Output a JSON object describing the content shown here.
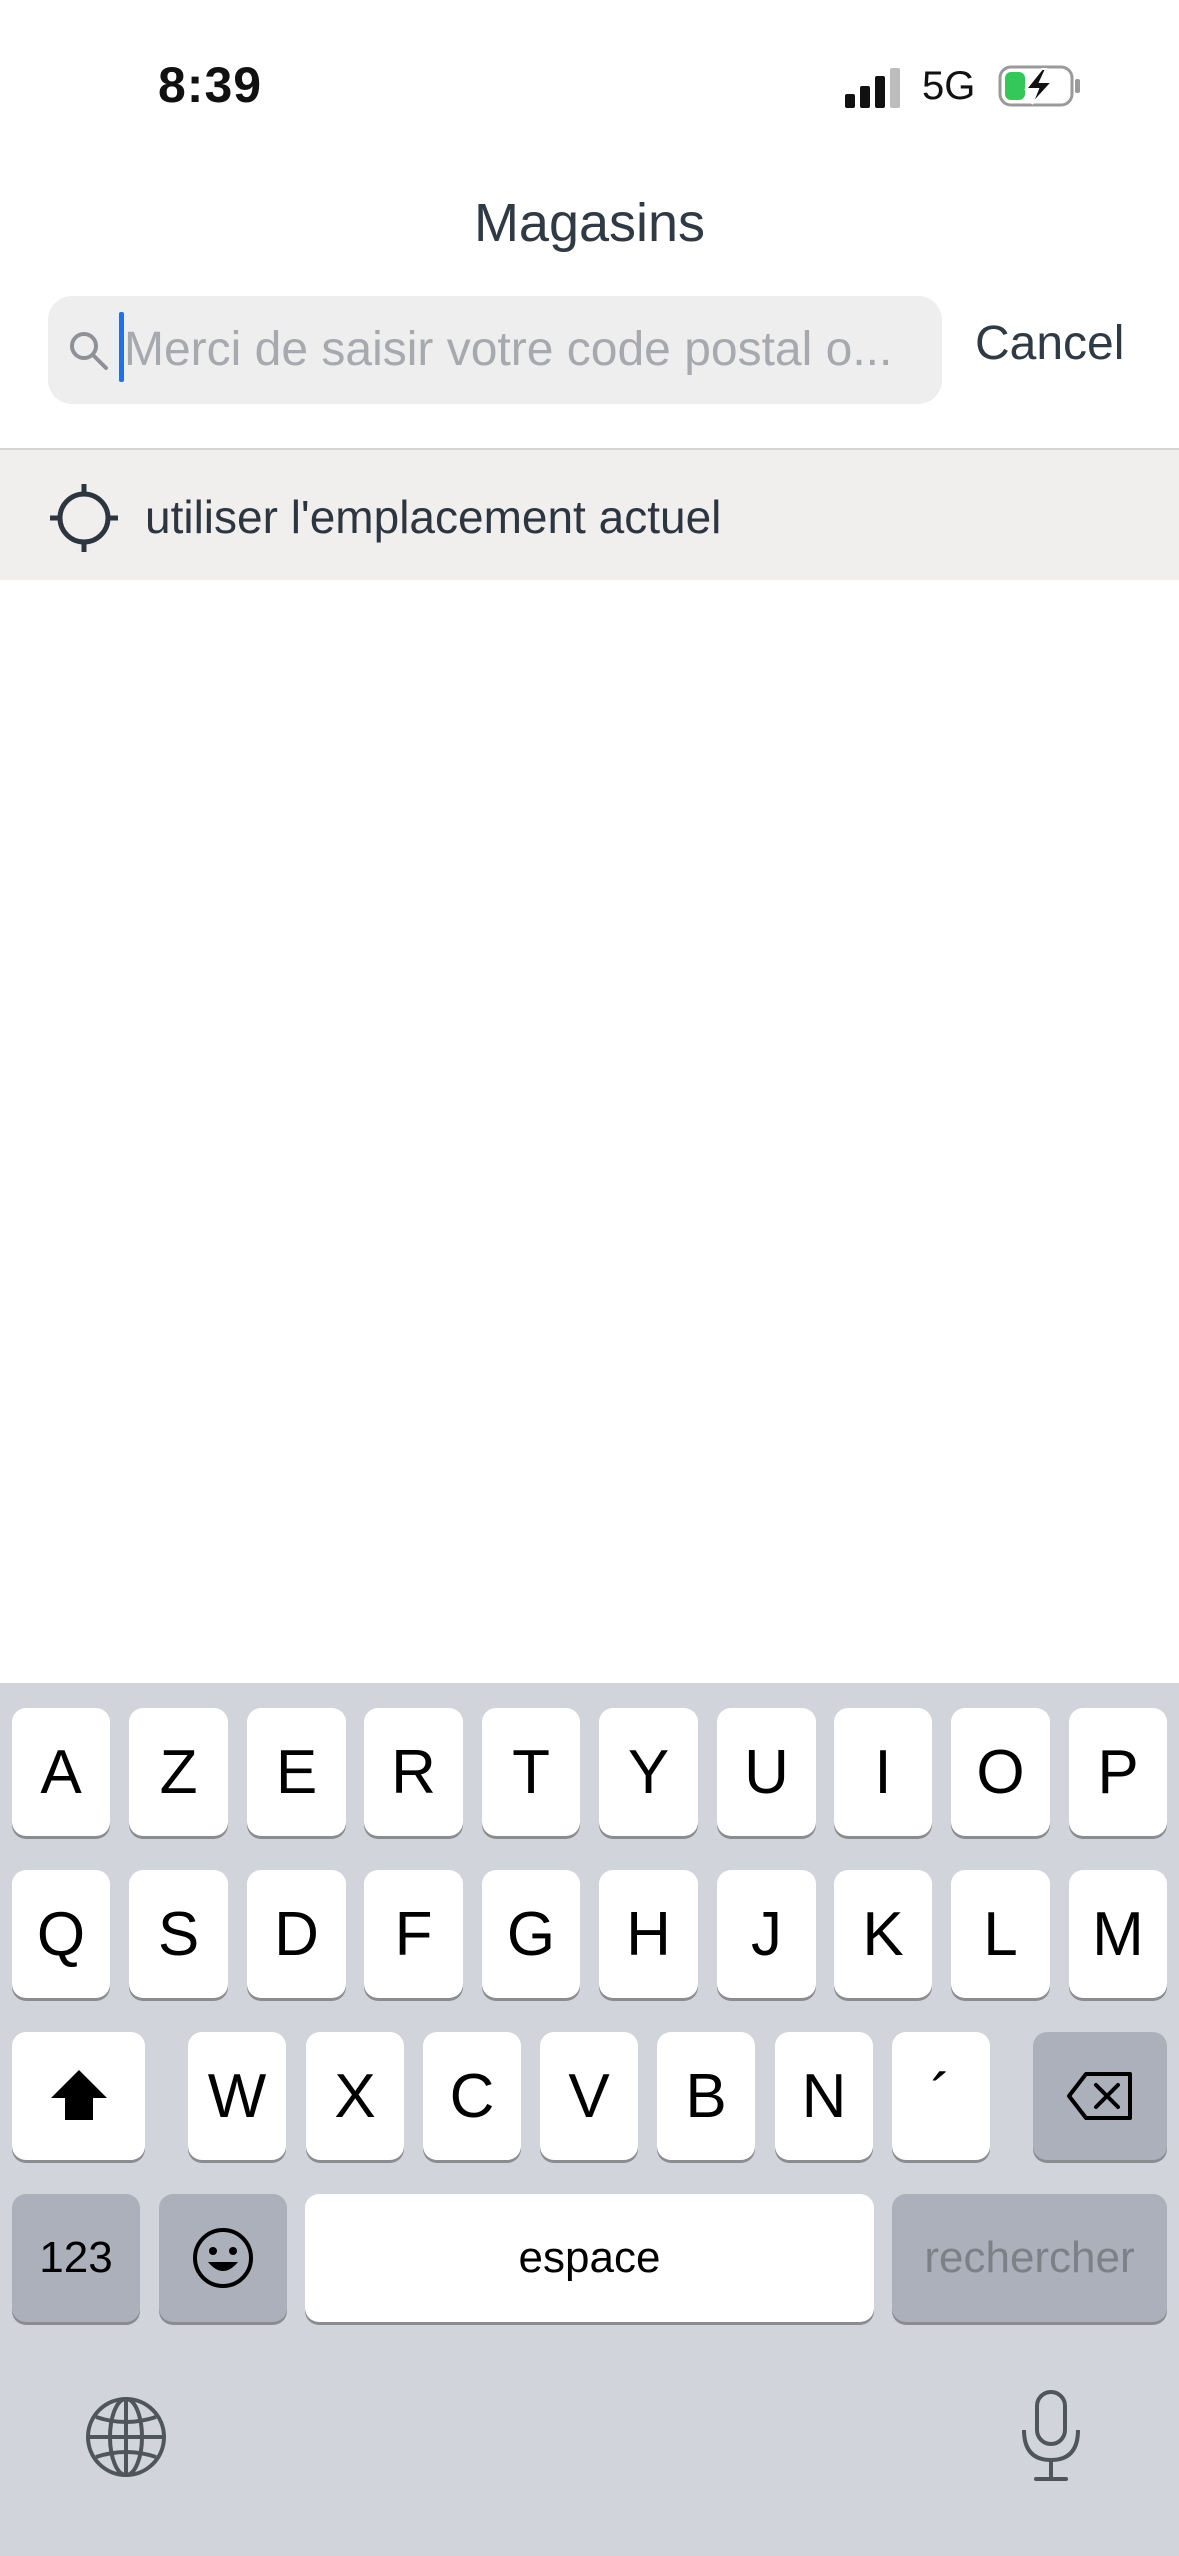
{
  "status_bar": {
    "time": "8:39",
    "network": "5G"
  },
  "header": {
    "title": "Magasins"
  },
  "search": {
    "placeholder": "Merci de saisir votre code postal o...",
    "value": "",
    "cancel_label": "Cancel"
  },
  "location_option": {
    "label": "utiliser l'emplacement actuel"
  },
  "keyboard": {
    "row1": [
      "A",
      "Z",
      "E",
      "R",
      "T",
      "Y",
      "U",
      "I",
      "O",
      "P"
    ],
    "row2": [
      "Q",
      "S",
      "D",
      "F",
      "G",
      "H",
      "J",
      "K",
      "L",
      "M"
    ],
    "row3": [
      "W",
      "X",
      "C",
      "V",
      "B",
      "N",
      "´"
    ],
    "numbers_label": "123",
    "space_label": "espace",
    "search_label": "rechercher"
  },
  "colors": {
    "accent": "#1a73e8",
    "battery_charge": "#34c759",
    "keyboard_bg": "#d1d4db"
  }
}
